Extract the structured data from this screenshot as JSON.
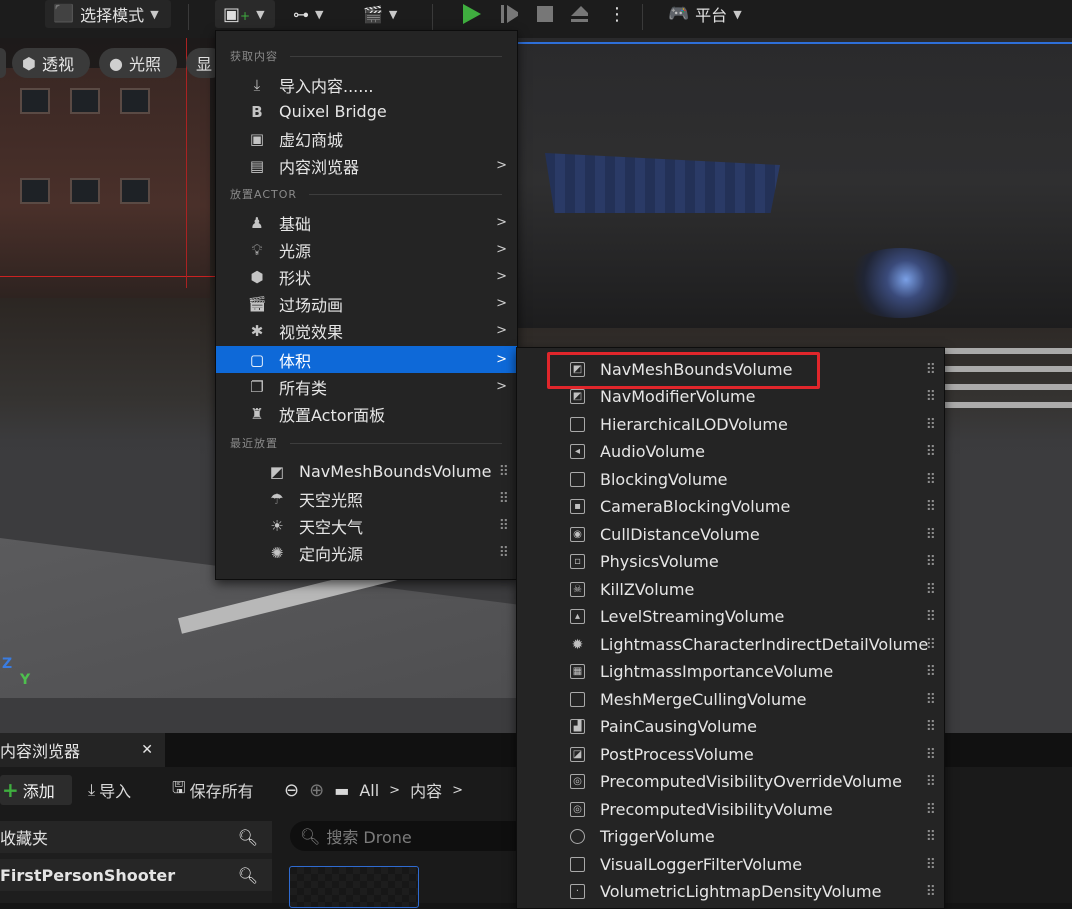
{
  "toolbar": {
    "mode_label": "选择模式",
    "platform_label": "平台",
    "play_color": "#3fae3f"
  },
  "viewport": {
    "perspective_label": "透视",
    "lighting_label": "光照",
    "show_label": "显",
    "axis_z": "Z",
    "axis_y": "Y"
  },
  "menu": {
    "section_get_content": "获取内容",
    "section_place_actor": "放置ACTOR",
    "section_recent": "最近放置",
    "items": [
      {
        "label": "导入内容......",
        "icon": "import-icon",
        "has_arrow": false
      },
      {
        "label": "Quixel Bridge",
        "icon": "bridge-icon",
        "has_arrow": false
      },
      {
        "label": "虚幻商城",
        "icon": "marketplace-icon",
        "has_arrow": false
      },
      {
        "label": "内容浏览器",
        "icon": "content-browser-icon",
        "has_arrow": true
      },
      {
        "label": "基础",
        "icon": "basic-icon",
        "has_arrow": true
      },
      {
        "label": "光源",
        "icon": "light-icon",
        "has_arrow": true
      },
      {
        "label": "形状",
        "icon": "shape-icon",
        "has_arrow": true
      },
      {
        "label": "过场动画",
        "icon": "cinematic-icon",
        "has_arrow": true
      },
      {
        "label": "视觉效果",
        "icon": "visual-effects-icon",
        "has_arrow": true
      },
      {
        "label": "体积",
        "icon": "volume-icon",
        "has_arrow": true
      },
      {
        "label": "所有类",
        "icon": "all-classes-icon",
        "has_arrow": true
      },
      {
        "label": "放置Actor面板",
        "icon": "place-actor-icon",
        "has_arrow": false
      }
    ],
    "recent": [
      {
        "label": "NavMeshBoundsVolume",
        "icon": "navmesh-icon"
      },
      {
        "label": "天空光照",
        "icon": "sky-light-icon"
      },
      {
        "label": "天空大气",
        "icon": "sky-atmosphere-icon"
      },
      {
        "label": "定向光源",
        "icon": "directional-light-icon"
      }
    ]
  },
  "submenu": {
    "items": [
      "NavMeshBoundsVolume",
      "NavModifierVolume",
      "HierarchicalLODVolume",
      "AudioVolume",
      "BlockingVolume",
      "CameraBlockingVolume",
      "CullDistanceVolume",
      "PhysicsVolume",
      "KillZVolume",
      "LevelStreamingVolume",
      "LightmassCharacterIndirectDetailVolume",
      "LightmassImportanceVolume",
      "MeshMergeCullingVolume",
      "PainCausingVolume",
      "PostProcessVolume",
      "PrecomputedVisibilityOverrideVolume",
      "PrecomputedVisibilityVolume",
      "TriggerVolume",
      "VisualLoggerFilterVolume",
      "VolumetricLightmapDensityVolume"
    ],
    "highlight_color": "#e0262b"
  },
  "content_browser": {
    "tab_label": "内容浏览器",
    "add_label": "添加",
    "import_label": "导入",
    "save_all_label": "保存所有",
    "path_all": "All",
    "path_content": "内容",
    "favorites_label": "收藏夹",
    "project_label": "FirstPersonShooter",
    "search_placeholder": "搜索 Drone"
  }
}
